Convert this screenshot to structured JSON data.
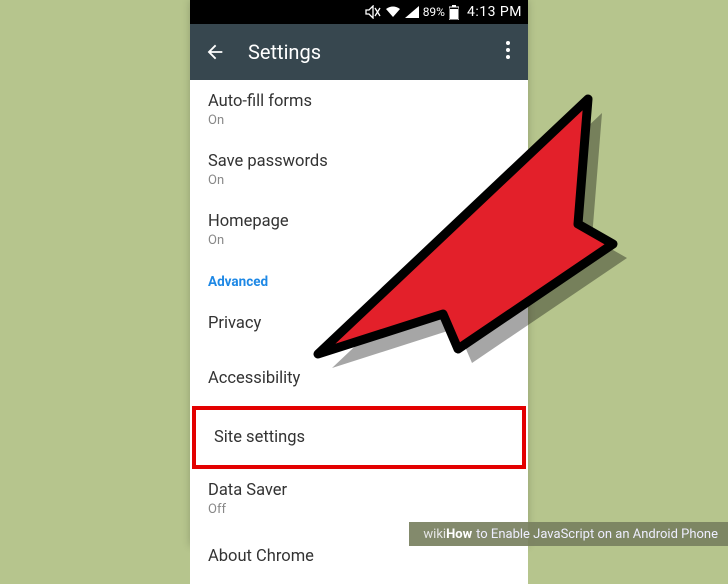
{
  "status_bar": {
    "battery_text": "89%",
    "time": "4:13 PM"
  },
  "app_bar": {
    "title": "Settings"
  },
  "items": {
    "autofill": {
      "title": "Auto-fill forms",
      "subtitle": "On"
    },
    "save_passwords": {
      "title": "Save passwords",
      "subtitle": "On"
    },
    "homepage": {
      "title": "Homepage",
      "subtitle": "On"
    },
    "advanced_header": "Advanced",
    "privacy": "Privacy",
    "accessibility": "Accessibility",
    "site_settings": "Site settings",
    "data_saver": {
      "title": "Data Saver",
      "subtitle": "Off"
    },
    "about_chrome": "About Chrome"
  },
  "watermark": {
    "brand1": "wiki",
    "brand2": "How",
    "text": " to Enable JavaScript on an Android Phone"
  }
}
